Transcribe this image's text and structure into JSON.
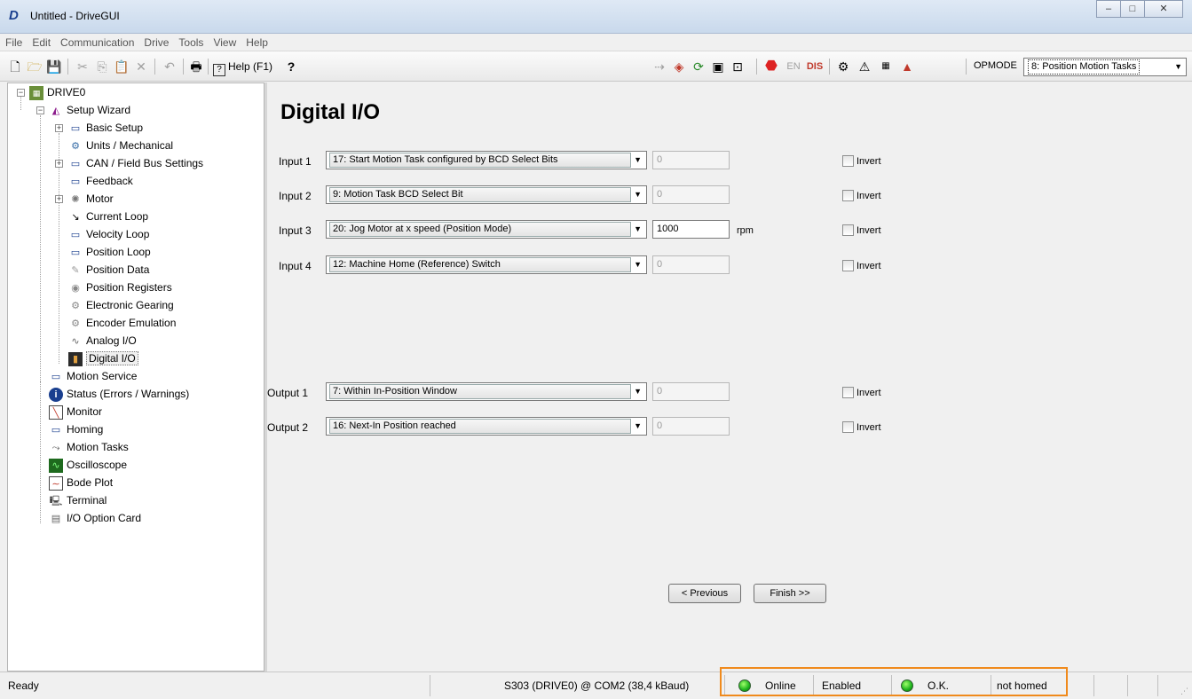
{
  "window": {
    "title": "Untitled - DriveGUI",
    "min": "–",
    "max": "□",
    "close": "✕"
  },
  "menu": [
    "File",
    "Edit",
    "Communication",
    "Drive",
    "Tools",
    "View",
    "Help"
  ],
  "toolbar": {
    "help_label": "Help (F1)",
    "help_key": "?",
    "en_label": "EN",
    "dis_label": "DIS",
    "opmode_label": "OPMODE",
    "opmode_value": "8: Position Motion Tasks"
  },
  "tree": {
    "root": "DRIVE0",
    "items": [
      "Setup Wizard",
      "Basic Setup",
      "Units / Mechanical",
      "CAN / Field Bus Settings",
      "Feedback",
      "Motor",
      "Current Loop",
      "Velocity Loop",
      "Position Loop",
      "Position Data",
      "Position Registers",
      "Electronic Gearing",
      "Encoder Emulation",
      "Analog I/O",
      "Digital I/O",
      "Motion Service",
      "Status (Errors / Warnings)",
      "Monitor",
      "Homing",
      "Motion Tasks",
      "Oscilloscope",
      "Bode Plot",
      "Terminal",
      "I/O Option Card"
    ]
  },
  "main": {
    "title": "Digital I/O",
    "invert_label": "Invert",
    "inputs": [
      {
        "label": "Input 1",
        "function": "17: Start Motion Task configured by BCD Select Bits",
        "value": "0",
        "unit": ""
      },
      {
        "label": "Input 2",
        "function": "9: Motion Task BCD Select Bit",
        "value": "0",
        "unit": ""
      },
      {
        "label": "Input 3",
        "function": "20: Jog Motor at x speed (Position Mode)",
        "value": "1000",
        "unit": "rpm"
      },
      {
        "label": "Input 4",
        "function": "12: Machine Home (Reference) Switch",
        "value": "0",
        "unit": ""
      }
    ],
    "outputs": [
      {
        "label": "Output 1",
        "function": "7: Within In-Position Window",
        "value": "0"
      },
      {
        "label": "Output 2",
        "function": "16: Next-In Position reached",
        "value": "0"
      }
    ],
    "previous_label": "< Previous",
    "finish_label": "Finish >>"
  },
  "status": {
    "left": "Ready",
    "connection": "S303 (DRIVE0) @ COM2 (38,4 kBaud)",
    "online": "Online",
    "enabled": "Enabled",
    "ok": "O.K.",
    "homed": "not homed"
  },
  "colors": {
    "highlight": "#f08a1c",
    "led": "#1db31d",
    "brand": "#1a3f8f"
  }
}
